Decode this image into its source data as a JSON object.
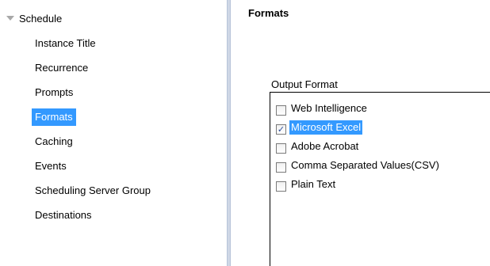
{
  "nav": {
    "root_label": "Schedule",
    "items": [
      {
        "label": "Instance Title",
        "selected": false
      },
      {
        "label": "Recurrence",
        "selected": false
      },
      {
        "label": "Prompts",
        "selected": false
      },
      {
        "label": "Formats",
        "selected": true
      },
      {
        "label": "Caching",
        "selected": false
      },
      {
        "label": "Events",
        "selected": false
      },
      {
        "label": "Scheduling Server Group",
        "selected": false
      },
      {
        "label": "Destinations",
        "selected": false
      }
    ]
  },
  "content": {
    "title": "Formats",
    "output_format_label": "Output Format",
    "options": [
      {
        "label": "Web Intelligence",
        "checked": false
      },
      {
        "label": "Microsoft Excel",
        "checked": true
      },
      {
        "label": "Adobe Acrobat",
        "checked": false
      },
      {
        "label": "Comma Separated Values(CSV)",
        "checked": false
      },
      {
        "label": "Plain Text",
        "checked": false
      }
    ]
  },
  "colors": {
    "selection": "#3399ff",
    "splitter": "#cfd8e6"
  }
}
